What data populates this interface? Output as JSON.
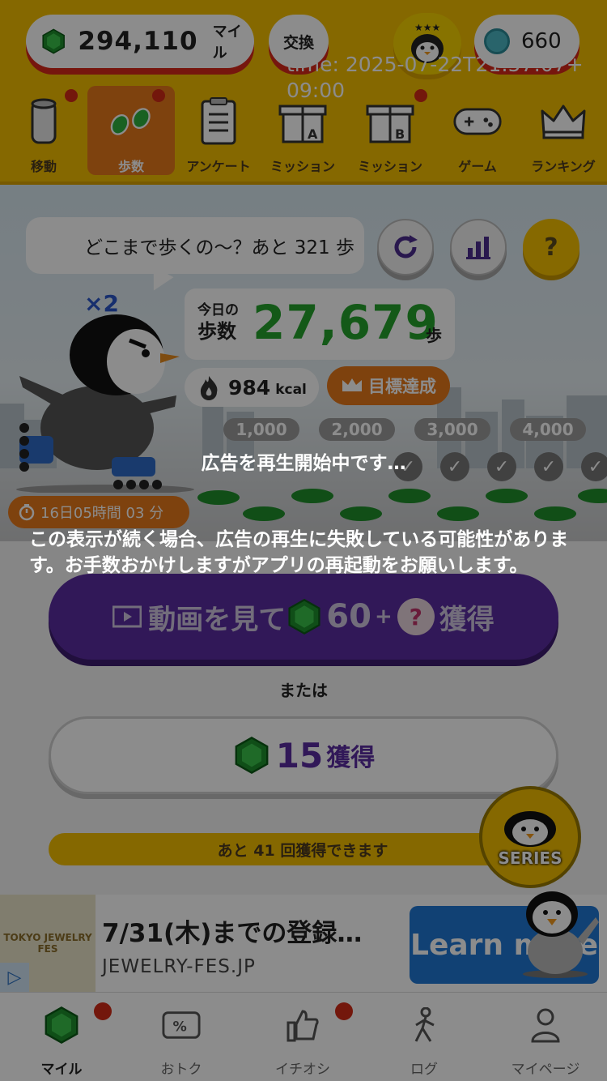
{
  "header": {
    "miles_value": "294,110",
    "miles_unit": "マイル",
    "exchange_label": "交換",
    "coin_value": "660",
    "time_text": "time: 2025-07-22T21:57:07+09:00"
  },
  "nav": {
    "items": [
      {
        "label": "移動",
        "icon": "tube-icon"
      },
      {
        "label": "歩数",
        "icon": "footprints-icon"
      },
      {
        "label": "アンケート",
        "icon": "clipboard-icon"
      },
      {
        "label": "ミッション",
        "icon": "gift-a-icon"
      },
      {
        "label": "ミッション",
        "icon": "gift-b-icon"
      },
      {
        "label": "ゲーム",
        "icon": "gamepad-icon"
      },
      {
        "label": "ランキング",
        "icon": "crown-icon"
      }
    ]
  },
  "scene": {
    "speech": "どこまで歩くの〜？あと 321 歩",
    "multiplier": "×2",
    "steps_label_top": "今日の",
    "steps_label_bottom": "歩数",
    "steps_value": "27,679",
    "steps_unit": "歩",
    "kcal_value": "984",
    "kcal_unit": "kcal",
    "goal_label": "目標達成",
    "milestones": [
      "1,000",
      "2,000",
      "3,000",
      "4,000"
    ],
    "timer": "16日05時間 03 分",
    "help_label": "?"
  },
  "actions": {
    "video_label": "動画を見て",
    "video_amount": "60",
    "video_plus": "+",
    "video_suffix": "獲得",
    "or_text": "または",
    "gain_amount": "15",
    "gain_label": "獲得",
    "remain_text": "あと 41 回獲得できます",
    "series_label": "SERIES"
  },
  "ad": {
    "image_text": "TOKYO JEWELRY FES",
    "title": "7/31(木)までの登録…",
    "url": "JEWELRY-FES.JP",
    "cta": "Learn more"
  },
  "tabs": [
    {
      "label": "マイル",
      "icon": "gem-icon"
    },
    {
      "label": "おトク",
      "icon": "coupon-icon"
    },
    {
      "label": "イチオシ",
      "icon": "thumbs-up-icon"
    },
    {
      "label": "ログ",
      "icon": "walker-icon"
    },
    {
      "label": "マイページ",
      "icon": "person-icon"
    }
  ],
  "overlay": {
    "loading": "広告を再生開始中です…",
    "message": "この表示が続く場合、広告の再生に失敗している可能性があります。お手数おかけしますがアプリの再起動をお願いします。"
  },
  "colors": {
    "header_yellow": "#f3be00",
    "active_orange": "#e6781b",
    "steps_green": "#26a32d",
    "video_purple": "#5a2ca0",
    "badge_red": "#d22b16"
  }
}
